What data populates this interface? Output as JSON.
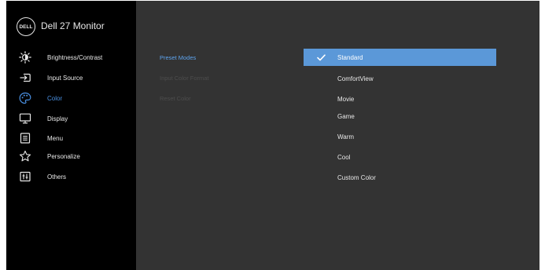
{
  "header": {
    "logo_text": "DELL",
    "title": "Dell 27 Monitor"
  },
  "sidebar": {
    "items": [
      {
        "label": "Brightness/Contrast",
        "icon": "brightness-icon"
      },
      {
        "label": "Input Source",
        "icon": "input-source-icon"
      },
      {
        "label": "Color",
        "icon": "color-palette-icon",
        "active": true
      },
      {
        "label": "Display",
        "icon": "display-icon"
      },
      {
        "label": "Menu",
        "icon": "menu-icon"
      },
      {
        "label": "Personalize",
        "icon": "star-icon"
      },
      {
        "label": "Others",
        "icon": "others-icon"
      }
    ]
  },
  "submenu": {
    "items": [
      {
        "label": "Preset Modes",
        "state": "active"
      },
      {
        "label": "Input Color Format",
        "state": "disabled"
      },
      {
        "label": "Reset Color",
        "state": "disabled"
      }
    ]
  },
  "preset_modes": {
    "options": [
      {
        "label": "Standard",
        "selected": true
      },
      {
        "label": "ComfortView"
      },
      {
        "label": "Movie"
      },
      {
        "label": "Game"
      },
      {
        "label": "Warm"
      },
      {
        "label": "Cool"
      },
      {
        "label": "Custom Color"
      }
    ]
  },
  "colors": {
    "sidebar_bg": "#000000",
    "main_bg": "#333333",
    "accent": "#4a90e2",
    "selected_row_bg": "#5b98d8",
    "disabled_text": "#4d4d4d"
  }
}
